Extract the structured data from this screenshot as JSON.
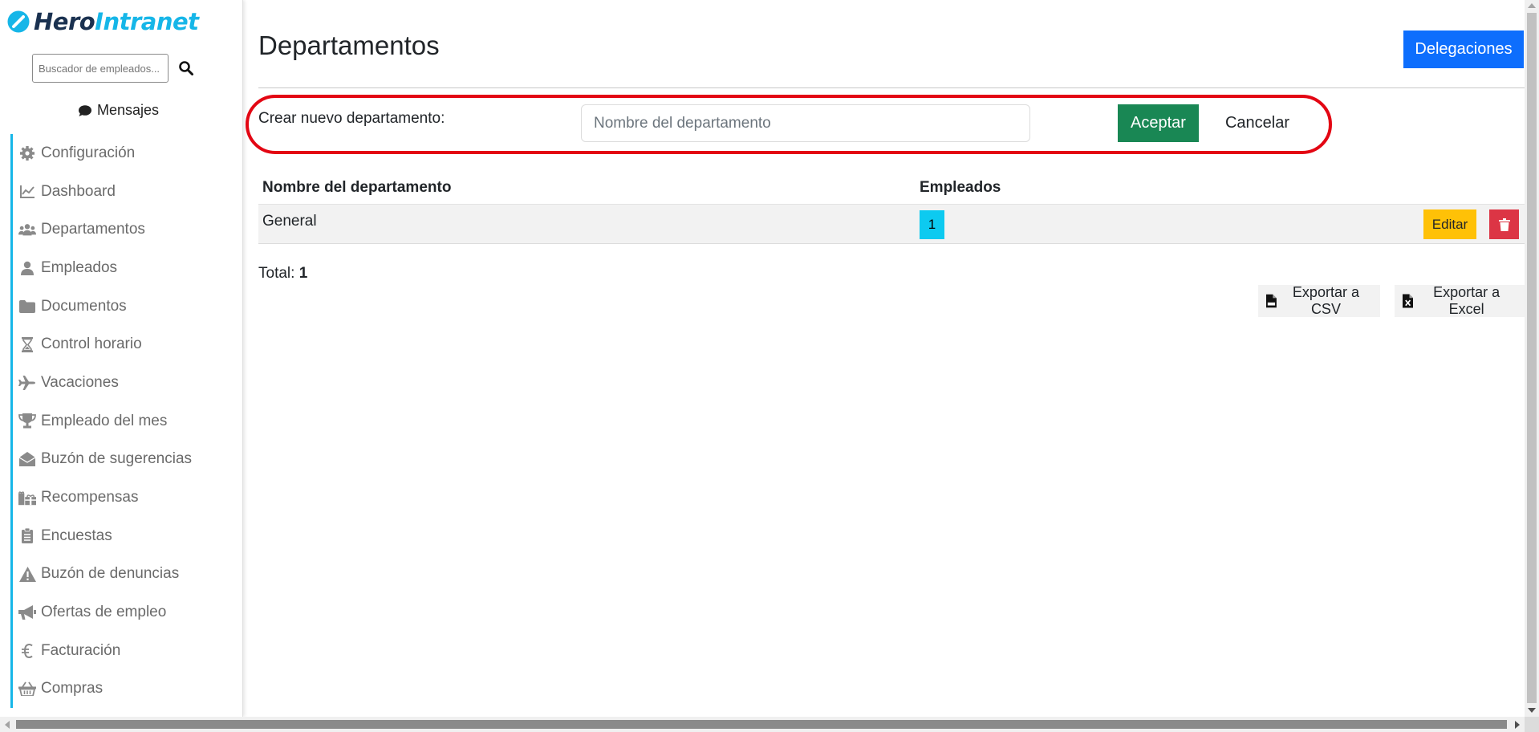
{
  "brand": {
    "name_part1": "Hero",
    "name_part2": "Intranet",
    "color_dark": "#1a3150",
    "color_accent": "#16b6e8"
  },
  "sidebar": {
    "search_placeholder": "Buscador de empleados...",
    "messages_label": "Mensajes",
    "items": [
      {
        "label": "Configuración",
        "icon": "gear-icon"
      },
      {
        "label": "Dashboard",
        "icon": "chart-line-icon"
      },
      {
        "label": "Departamentos",
        "icon": "users-icon"
      },
      {
        "label": "Empleados",
        "icon": "user-icon"
      },
      {
        "label": "Documentos",
        "icon": "folder-icon"
      },
      {
        "label": "Control horario",
        "icon": "hourglass-icon"
      },
      {
        "label": "Vacaciones",
        "icon": "plane-icon"
      },
      {
        "label": "Empleado del mes",
        "icon": "trophy-icon"
      },
      {
        "label": "Buzón de sugerencias",
        "icon": "envelope-open-icon"
      },
      {
        "label": "Recompensas",
        "icon": "gifts-icon"
      },
      {
        "label": "Encuestas",
        "icon": "clipboard-icon"
      },
      {
        "label": "Buzón de denuncias",
        "icon": "warning-icon"
      },
      {
        "label": "Ofertas de empleo",
        "icon": "megaphone-icon"
      },
      {
        "label": "Facturación",
        "icon": "euro-icon"
      },
      {
        "label": "Compras",
        "icon": "basket-icon"
      }
    ]
  },
  "header": {
    "title": "Departamentos",
    "delegaciones_label": "Delegaciones"
  },
  "create_form": {
    "label": "Crear nuevo departamento:",
    "placeholder": "Nombre del departamento",
    "value": "",
    "accept_label": "Aceptar",
    "cancel_label": "Cancelar"
  },
  "table": {
    "columns": [
      "Nombre del departamento",
      "Empleados"
    ],
    "rows": [
      {
        "name": "General",
        "employees": "1",
        "edit_label": "Editar"
      }
    ]
  },
  "footer": {
    "total_label": "Total:",
    "total_value": "1",
    "export_csv_label": "Exportar a CSV",
    "export_excel_label": "Exportar a Excel"
  },
  "colors": {
    "primary": "#0d6efd",
    "success": "#198754",
    "warning": "#ffc107",
    "danger": "#dc3545",
    "info": "#0dcaf0",
    "highlight": "#e30613"
  }
}
